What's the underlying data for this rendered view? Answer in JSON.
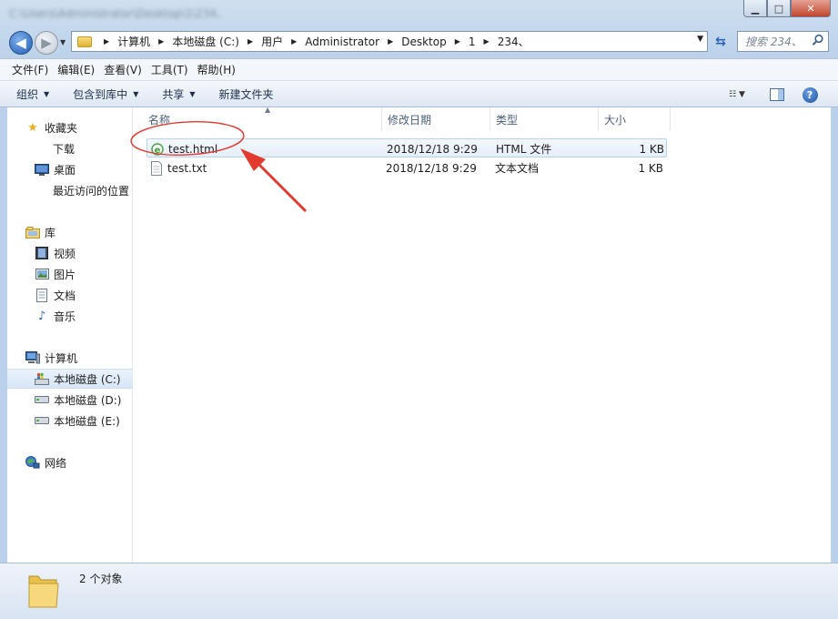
{
  "window": {
    "title": "C:\\Users\\Administrator\\Desktop\\1\\234、",
    "minimize_glyph": "▁",
    "maximize_glyph": "□",
    "close_glyph": "✕"
  },
  "nav": {
    "back_glyph": "◀",
    "forward_glyph": "▶",
    "recent_glyph": "▼",
    "breadcrumbs": [
      "计算机",
      "本地磁盘 (C:)",
      "用户",
      "Administrator",
      "Desktop",
      "1",
      "234、"
    ],
    "breadcrumb_sep": "▶",
    "dropdown_glyph": "▼",
    "refresh_glyph": "⇆",
    "search_placeholder": "搜索 234、"
  },
  "menu": [
    "文件(F)",
    "编辑(E)",
    "查看(V)",
    "工具(T)",
    "帮助(H)"
  ],
  "toolbar": {
    "organize": "组织",
    "include_in_library": "包含到库中",
    "share": "共享",
    "new_folder": "新建文件夹",
    "caret": "▼",
    "view_glyph": "☷ ▼",
    "help_glyph": "?"
  },
  "sidebar": {
    "favorites": {
      "label": "收藏夹",
      "items": [
        "下载",
        "桌面",
        "最近访问的位置"
      ]
    },
    "libraries": {
      "label": "库",
      "items": [
        "视频",
        "图片",
        "文档",
        "音乐"
      ]
    },
    "computer": {
      "label": "计算机",
      "items": [
        "本地磁盘 (C:)",
        "本地磁盘 (D:)",
        "本地磁盘 (E:)"
      ],
      "selected_index": 0
    },
    "network": {
      "label": "网络"
    }
  },
  "file_list": {
    "sort_glyph": "▲",
    "columns": [
      "名称",
      "修改日期",
      "类型",
      "大小"
    ],
    "rows": [
      {
        "name": "test.html",
        "date": "2018/12/18 9:29",
        "type": "HTML 文件",
        "size": "1 KB",
        "icon": "ie-html-icon"
      },
      {
        "name": "test.txt",
        "date": "2018/12/18 9:29",
        "type": "文本文档",
        "size": "1 KB",
        "icon": "text-file-icon"
      }
    ]
  },
  "status": {
    "text": "2 个对象"
  },
  "colors": {
    "annotation": "#e23a2e",
    "accent": "#1e5fb5",
    "selection": "#d7e6f7"
  }
}
